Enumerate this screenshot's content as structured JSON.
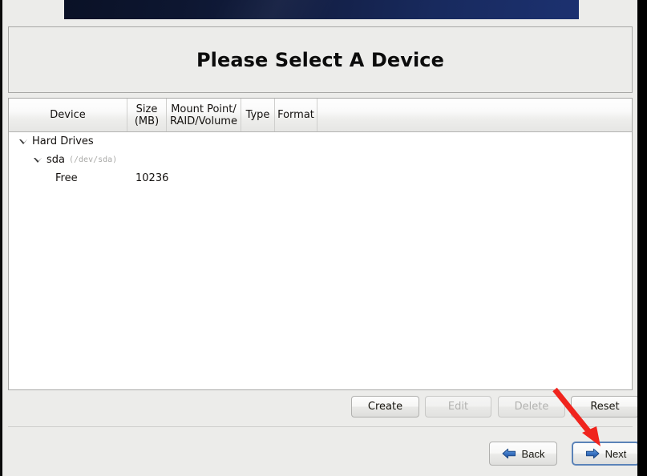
{
  "window": {
    "title": "Please Select A Device",
    "banner_gradient_from": "#0a1126",
    "banner_gradient_to": "#1c3170",
    "background_color": "#ececea"
  },
  "table": {
    "columns": [
      {
        "key": "device",
        "label": "Device"
      },
      {
        "key": "size",
        "label": "Size\n(MB)"
      },
      {
        "key": "mount",
        "label": "Mount Point/\nRAID/Volume"
      },
      {
        "key": "type",
        "label": "Type"
      },
      {
        "key": "format",
        "label": "Format"
      }
    ],
    "rows": [
      {
        "indent": 0,
        "expander": "expanded",
        "device": "Hard Drives",
        "device_detail": "",
        "size": "",
        "mount": "",
        "type": "",
        "format": ""
      },
      {
        "indent": 1,
        "expander": "expanded",
        "device": "sda",
        "device_detail": "(/dev/sda)",
        "size": "",
        "mount": "",
        "type": "",
        "format": ""
      },
      {
        "indent": 2,
        "expander": "none",
        "device": "Free",
        "device_detail": "",
        "size": "10236",
        "mount": "",
        "type": "",
        "format": ""
      }
    ]
  },
  "actions": {
    "create_label": "Create",
    "edit_label": "Edit",
    "delete_label": "Delete",
    "reset_label": "Reset",
    "edit_enabled": false,
    "delete_enabled": false
  },
  "navigation": {
    "back_label": "Back",
    "next_label": "Next",
    "next_focused": true,
    "arrow_color": "#2a63b0"
  },
  "annotation": {
    "type": "arrow",
    "color": "#f0241d",
    "points_to": "next-button"
  }
}
